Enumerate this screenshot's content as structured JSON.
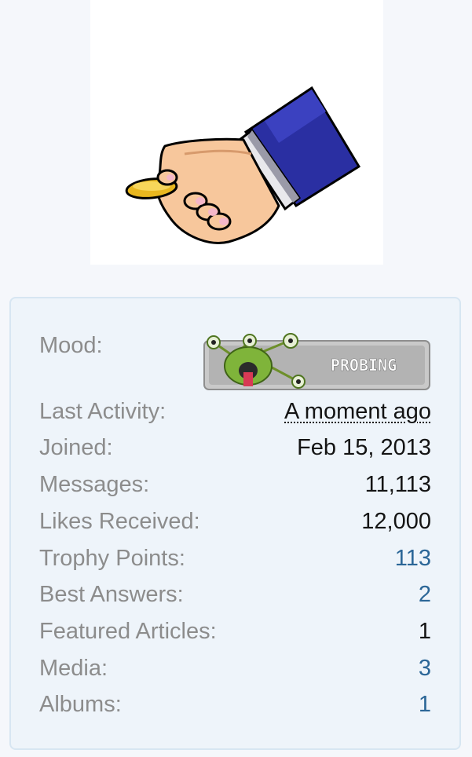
{
  "avatar": {
    "icon": "hand-with-coin-icon"
  },
  "profile_stats": {
    "mood": {
      "label": "Mood:",
      "badge_text": "PROBING",
      "badge_icon": "green-alien-icon"
    },
    "rows": [
      {
        "label": "Last Activity:",
        "value": "A moment ago"
      },
      {
        "label": "Joined:",
        "value": "Feb 15, 2013"
      },
      {
        "label": "Messages:",
        "value": "11,113"
      },
      {
        "label": "Likes Received:",
        "value": "12,000"
      },
      {
        "label": "Trophy Points:",
        "value": "113"
      },
      {
        "label": "Best Answers:",
        "value": "2"
      },
      {
        "label": "Featured Articles:",
        "value": "1"
      },
      {
        "label": "Media:",
        "value": "3"
      },
      {
        "label": "Albums:",
        "value": "1"
      }
    ]
  },
  "colors": {
    "label": "#8c8c8c",
    "value": "#141414",
    "link": "#2b6697",
    "panel_bg": "#eef4fa",
    "panel_border": "#d7e6f2"
  }
}
